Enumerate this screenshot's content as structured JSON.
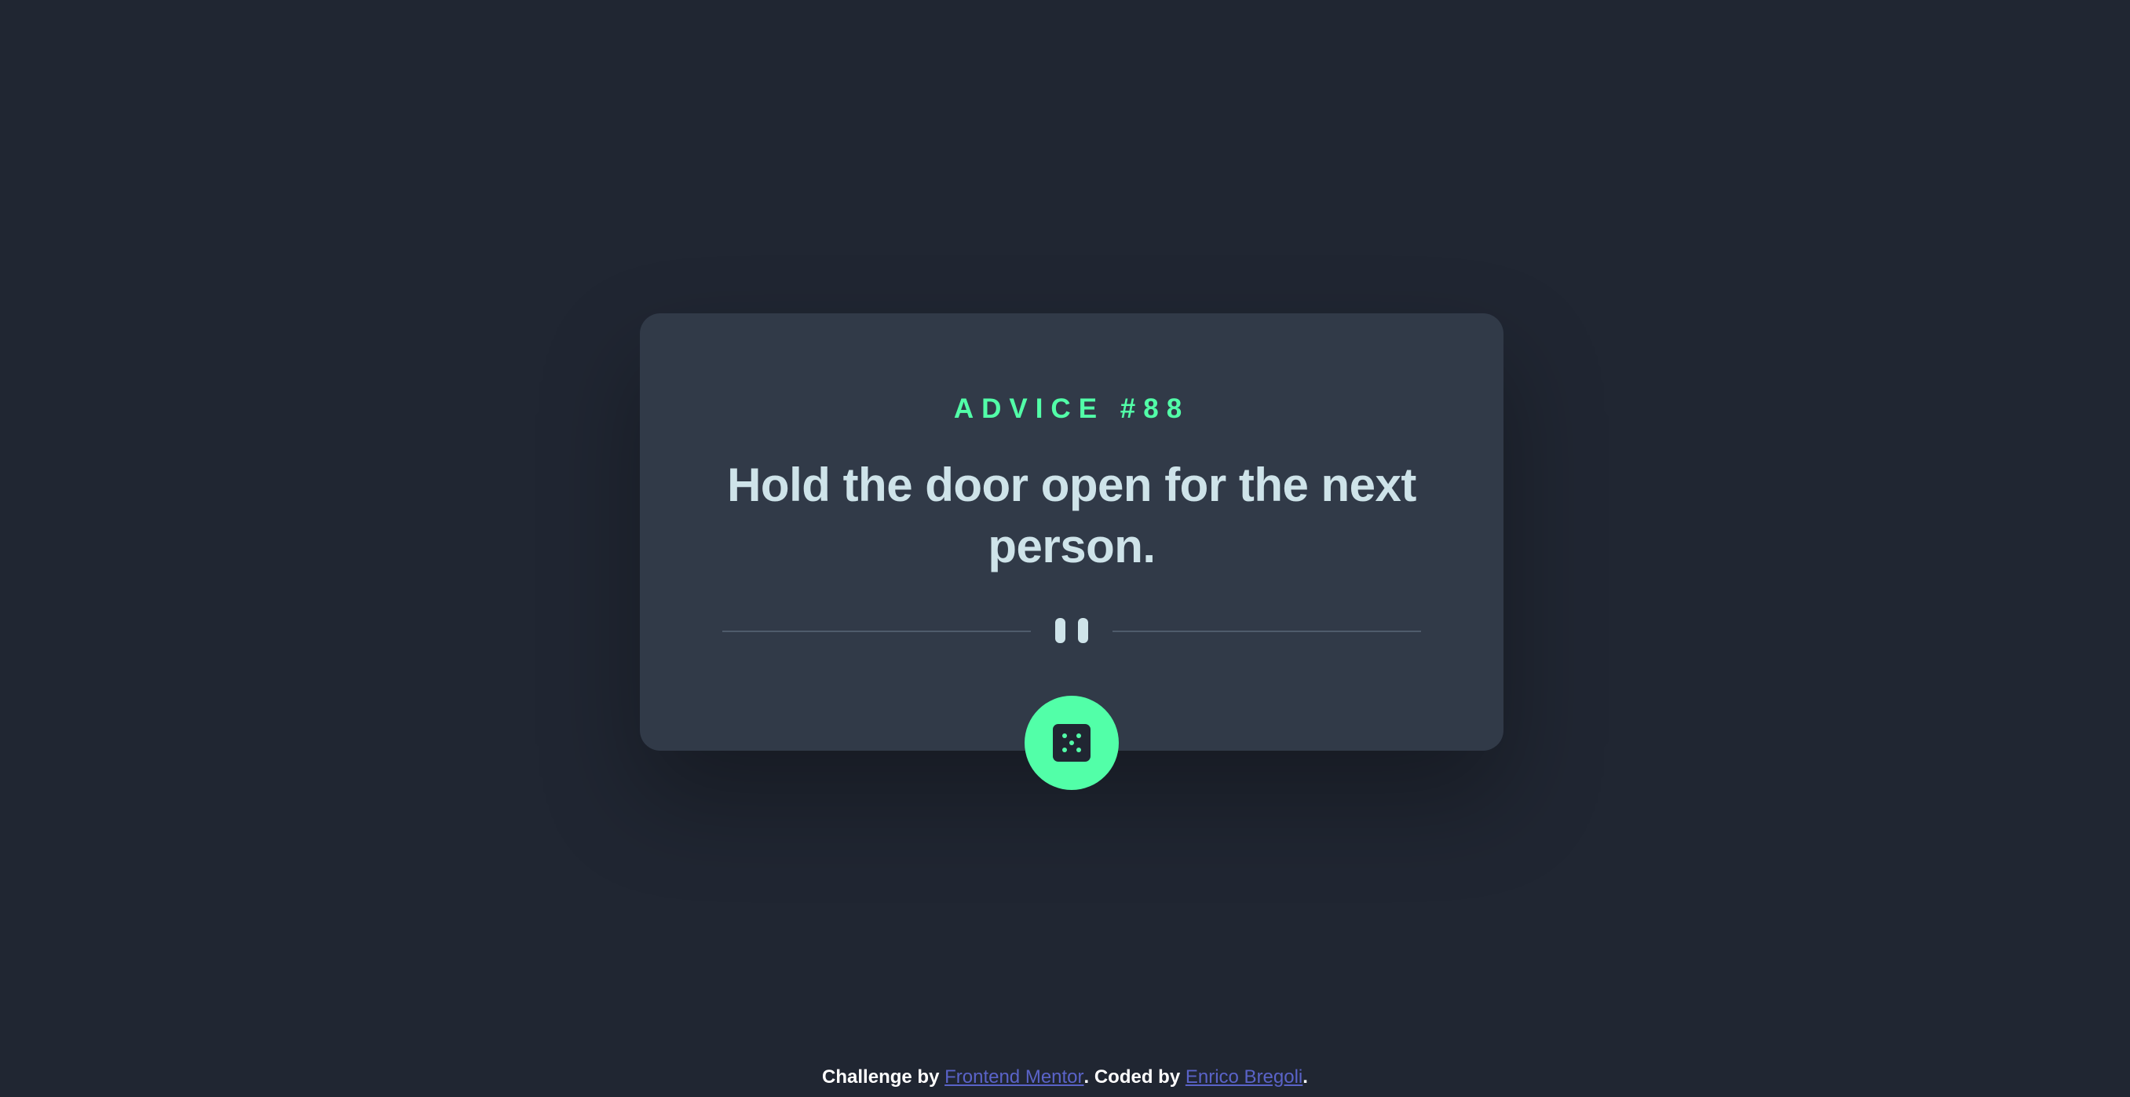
{
  "card": {
    "advice_id_label": "ADVICE #88",
    "advice_text": "Hold the door open for the next person."
  },
  "dice_button": {
    "icon": "dice-icon"
  },
  "divider": {
    "icon": "pause-icon"
  },
  "footer": {
    "challenge_prefix": "Challenge by ",
    "challenge_link": "Frontend Mentor",
    "coded_prefix": ". Coded by ",
    "coded_link": "Enrico Bregoli",
    "suffix": "."
  },
  "colors": {
    "background": "#202632",
    "card": "#313a48",
    "accent": "#52ffa8",
    "text": "#cee3e9",
    "link": "#5a63c8"
  }
}
